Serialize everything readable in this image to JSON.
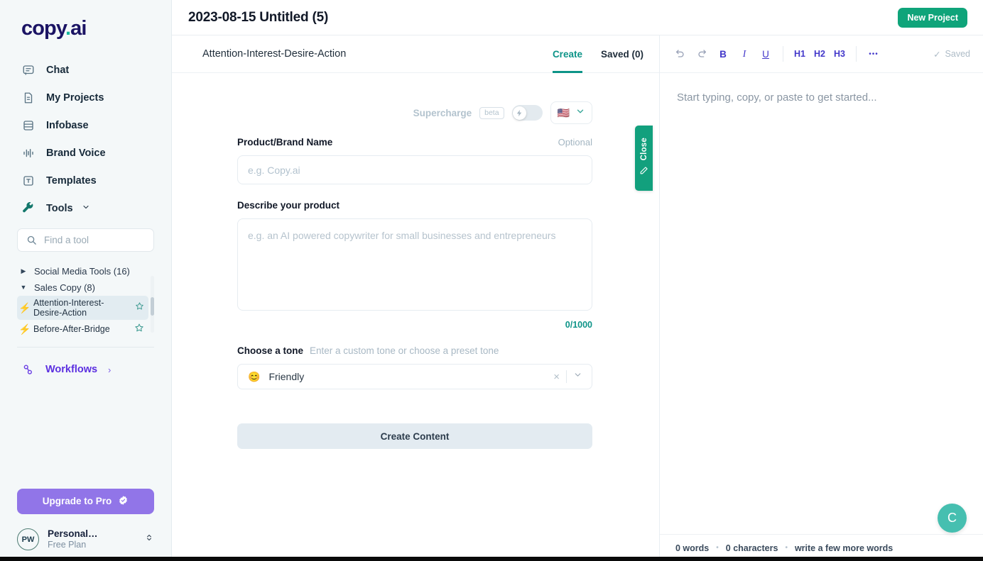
{
  "sidebar": {
    "logo": {
      "text": "copy",
      "dot": ".",
      "suffix": "ai"
    },
    "nav_items": [
      {
        "label": "Chat",
        "icon": "chat-bubble-icon"
      },
      {
        "label": "My Projects",
        "icon": "document-icon"
      },
      {
        "label": "Infobase",
        "icon": "database-icon"
      },
      {
        "label": "Brand Voice",
        "icon": "waveform-icon"
      },
      {
        "label": "Templates",
        "icon": "template-icon"
      }
    ],
    "tools": {
      "label": "Tools",
      "chevron": "chevron-down-icon"
    },
    "search": {
      "placeholder": "Find a tool",
      "value": "",
      "icon": "search-icon"
    },
    "tool_tree": [
      {
        "label": "Social Media Tools (16)",
        "expanded": false,
        "marker": "▶"
      },
      {
        "label": "Sales Copy (8)",
        "expanded": true,
        "marker": "▼"
      }
    ],
    "tool_items": [
      {
        "label": "Attention-Interest-Desire-Action",
        "active": true,
        "bolt": "⚡",
        "star": "star-outline-icon"
      },
      {
        "label": "Before-After-Bridge",
        "active": false,
        "bolt": "⚡",
        "star": "star-outline-icon"
      }
    ],
    "workflows": {
      "label": "Workflows",
      "chevron": "›",
      "icon": "workflow-nodes-icon"
    },
    "upgrade": {
      "label": "Upgrade to Pro",
      "badge": "✔",
      "color": "#9175e8"
    },
    "profile": {
      "initials": "PW",
      "name": "Personal…",
      "plan": "Free Plan",
      "switch_icon": "chevron-up-down-icon"
    }
  },
  "header": {
    "title": "2023-08-15 Untitled (5)",
    "new_project_label": "New Project",
    "new_project_color": "#0fa47a"
  },
  "form_panel": {
    "tool_name": "Attention-Interest-Desire-Action",
    "tabs": [
      {
        "label": "Create",
        "active": true
      },
      {
        "label": "Saved (0)",
        "active": false
      }
    ],
    "supercharge": {
      "label": "Supercharge",
      "beta": "beta",
      "toggle_state": "off",
      "bolt_icon": "lightning-bolt-icon"
    },
    "language": {
      "flag": "🇺🇸",
      "chevron": "chevron-down-icon"
    },
    "fields": [
      {
        "label": "Product/Brand Name",
        "optional": "Optional",
        "placeholder": "e.g. Copy.ai",
        "value": ""
      },
      {
        "label": "Describe your product",
        "placeholder": "e.g. an AI powered copywriter for small businesses and entrepreneurs",
        "value": "",
        "char_count": "0/1000"
      }
    ],
    "tone": {
      "label": "Choose a tone",
      "hint": "Enter a custom tone or choose a preset tone",
      "emoji": "😊",
      "value": "Friendly",
      "clear_icon": "×",
      "chevron": "chevron-down-icon"
    },
    "submit_label": "Create Content"
  },
  "editor": {
    "toolbar": [
      {
        "name": "undo",
        "glyph": "↶",
        "muted": true
      },
      {
        "name": "redo",
        "glyph": "↷",
        "muted": true
      },
      {
        "name": "bold",
        "glyph": "B",
        "muted": false
      },
      {
        "name": "italic",
        "glyph": "I",
        "muted": false
      },
      {
        "name": "underline",
        "glyph": "U",
        "muted": false
      },
      {
        "name": "h1",
        "glyph": "H1",
        "muted": false
      },
      {
        "name": "h2",
        "glyph": "H2",
        "muted": false
      },
      {
        "name": "h3",
        "glyph": "H3",
        "muted": false
      },
      {
        "name": "more",
        "glyph": "•••",
        "muted": false
      }
    ],
    "saved_state": {
      "check": "✓",
      "label": "Saved"
    },
    "placeholder": "Start typing, copy, or paste to get started...",
    "status": {
      "words": "0 words",
      "characters": "0 characters",
      "hint": "write a few more words",
      "separator": "•"
    }
  },
  "close_tab": {
    "label": "Close",
    "icon": "pencil-icon",
    "color": "#12a07d"
  },
  "fab": {
    "label": "C",
    "color": "#46bfb0"
  }
}
